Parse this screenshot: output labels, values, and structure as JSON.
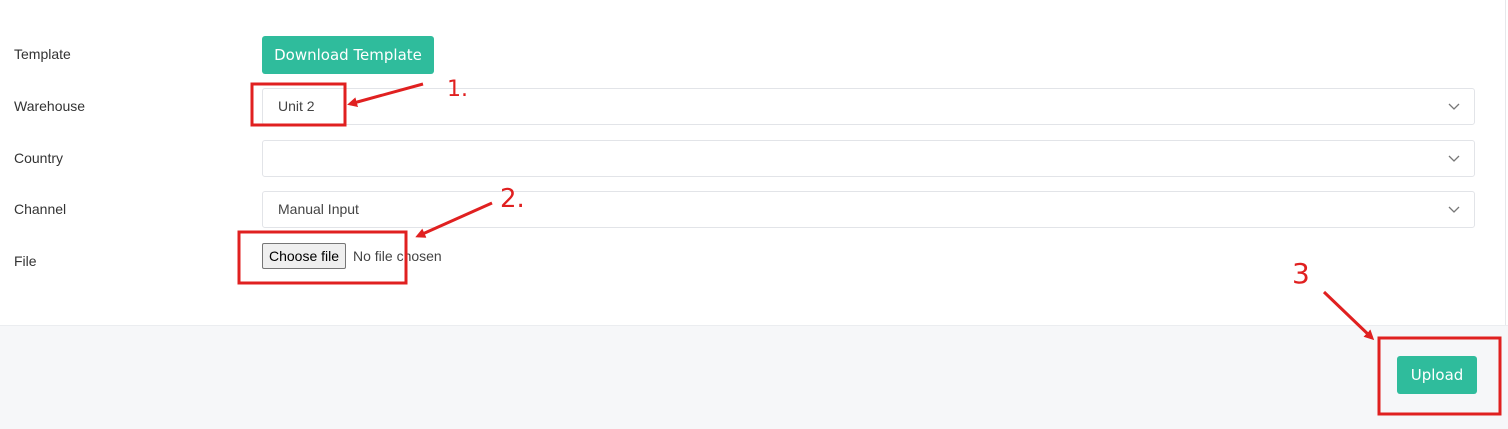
{
  "form": {
    "template": {
      "label": "Template",
      "button_label": "Download Template"
    },
    "warehouse": {
      "label": "Warehouse",
      "value": "Unit 2"
    },
    "country": {
      "label": "Country",
      "value": ""
    },
    "channel": {
      "label": "Channel",
      "value": "Manual Input"
    },
    "file": {
      "label": "File",
      "button_label": "Choose file",
      "status": "No file chosen"
    }
  },
  "footer": {
    "upload_label": "Upload"
  },
  "annotations": {
    "color": "#e02020",
    "markers": [
      "1.",
      "2.",
      "3"
    ]
  },
  "colors": {
    "accent": "#2fbc9c",
    "footer_bg": "#f6f7f9"
  },
  "icons": {
    "select_chevron": "chevron-down-icon"
  }
}
